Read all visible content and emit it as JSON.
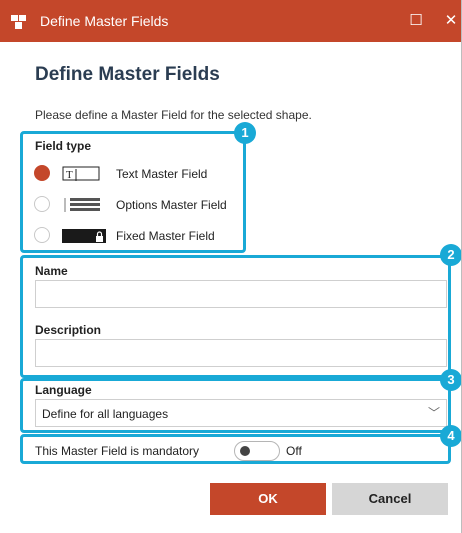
{
  "window": {
    "title": "Define Master Fields",
    "maximize_glyph": "☐",
    "close_glyph": "✕",
    "accent_color": "#c4472a",
    "highlight_color": "#19a9d6"
  },
  "dialog": {
    "heading": "Define Master Fields",
    "instructions": "Please define a Master Field for the selected shape."
  },
  "field_type": {
    "label": "Field type",
    "options": [
      {
        "label": "Text Master Field",
        "icon": "text-field-icon",
        "selected": true
      },
      {
        "label": "Options Master Field",
        "icon": "options-field-icon",
        "selected": false
      },
      {
        "label": "Fixed Master Field",
        "icon": "fixed-field-lock-icon",
        "selected": false
      }
    ]
  },
  "name": {
    "label": "Name",
    "value": ""
  },
  "description": {
    "label": "Description",
    "value": ""
  },
  "language": {
    "label": "Language",
    "selected": "Define for all languages",
    "chevron": "﹀"
  },
  "mandatory": {
    "label": "This Master Field is mandatory",
    "state": "Off"
  },
  "buttons": {
    "ok": "OK",
    "cancel": "Cancel"
  },
  "badges": [
    "1",
    "2",
    "3",
    "4"
  ]
}
